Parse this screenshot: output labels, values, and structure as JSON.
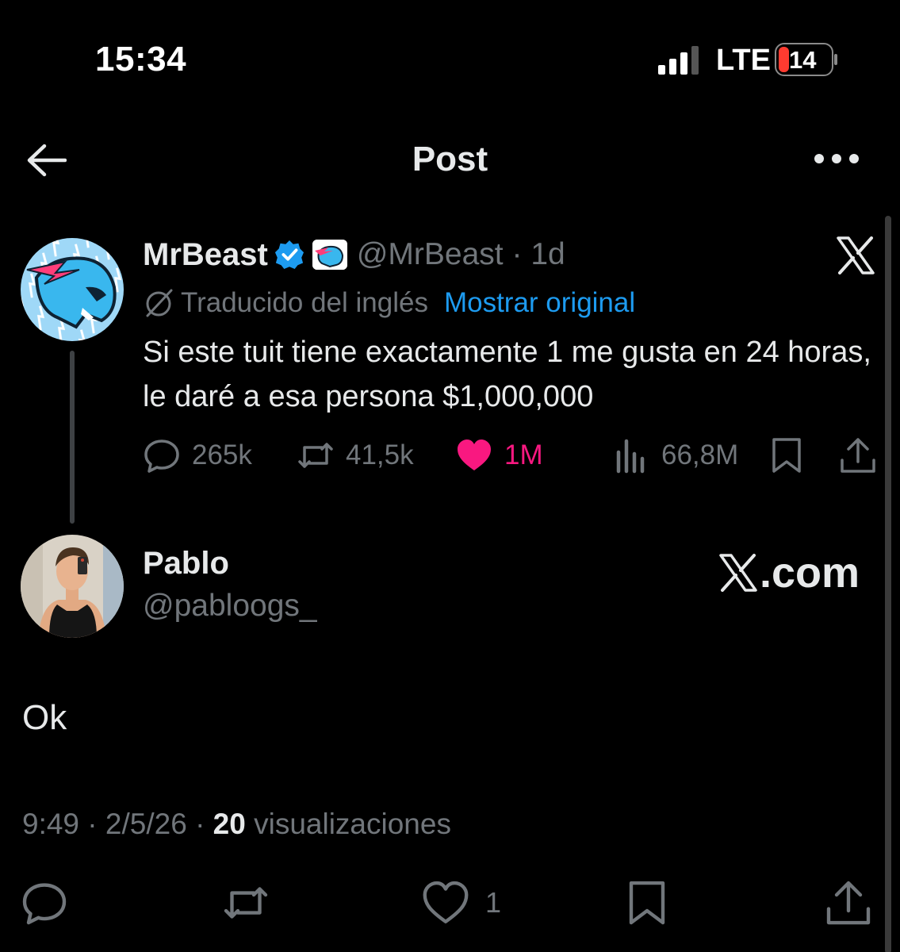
{
  "status_bar": {
    "time": "15:34",
    "network": "LTE",
    "battery": "14"
  },
  "header": {
    "title": "Post"
  },
  "quoted_post": {
    "author_name": "MrBeast",
    "handle": "@MrBeast",
    "separator": "·",
    "time_ago": "1d",
    "translated_label": "Traducido del inglés",
    "show_original": "Mostrar original",
    "text": "Si este tuit tiene exactamente 1 me gusta en 24 horas, le daré a esa persona $1,000,000",
    "stats": {
      "replies": "265k",
      "reposts": "41,5k",
      "likes": "1M",
      "views": "66,8M"
    },
    "colors": {
      "liked": "#f91880",
      "link": "#1d9bf0",
      "verified": "#1d9bf0"
    }
  },
  "reply_post": {
    "author_name": "Pablo",
    "handle": "@pabloogs_",
    "watermark": ".com",
    "text": "Ok",
    "time": "9:49",
    "date": "2/5/26",
    "views_count": "20",
    "views_label": "visualizaciones",
    "likes": "1"
  },
  "icons": [
    "back-arrow-icon",
    "more-icon",
    "verified-icon",
    "x-logo-icon",
    "translate-icon",
    "reply-icon",
    "repost-icon",
    "heart-icon",
    "views-icon",
    "bookmark-icon",
    "share-icon"
  ]
}
